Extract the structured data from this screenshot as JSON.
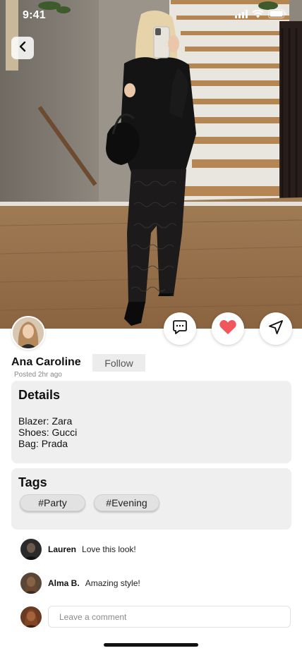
{
  "status_bar": {
    "time": "9:41"
  },
  "post": {
    "author": "Ana Caroline",
    "follow_label": "Follow",
    "posted": "Posted 2hr ago"
  },
  "details": {
    "title": "Details",
    "items": [
      "Blazer: Zara",
      "Shoes: Gucci",
      "Bag: Prada"
    ]
  },
  "tags": {
    "title": "Tags",
    "items": [
      "#Party",
      "#Evening"
    ]
  },
  "comments": [
    {
      "name": "Lauren",
      "text": "Love this look!"
    },
    {
      "name": "Alma B.",
      "text": "Amazing style!"
    }
  ],
  "comment_input": {
    "placeholder": "Leave a comment"
  },
  "colors": {
    "like": "#f0565c",
    "card": "#efefef",
    "follow_bg": "#ececec"
  },
  "icons": [
    "back-chevron-icon",
    "comment-bubble-icon",
    "heart-icon",
    "send-icon",
    "signal-icon",
    "wifi-icon",
    "battery-icon"
  ]
}
